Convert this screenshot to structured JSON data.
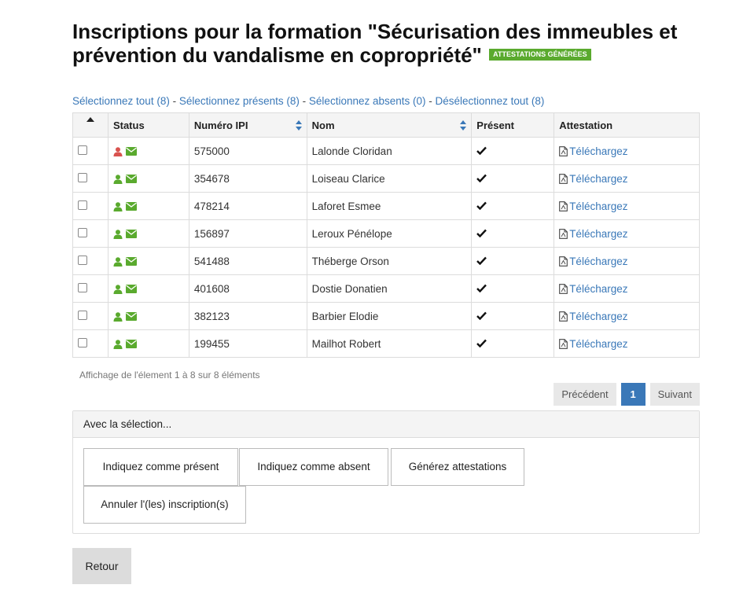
{
  "page": {
    "title": "Inscriptions pour la formation \"Sécurisation des immeubles et prévention du vandalisme en copropriété\"",
    "badge": "ATTESTATIONS GÉNÉRÉES"
  },
  "selection_links": {
    "all": "Sélectionnez tout (8)",
    "sep1": " - ",
    "present": "Sélectionnez présents (8)",
    "sep2": " - ",
    "absent": "Sélectionnez absents (0)",
    "sep3": " - ",
    "none": "Désélectionnez tout (8)"
  },
  "table": {
    "headers": {
      "status": "Status",
      "ipi": "Numéro IPI",
      "name": "Nom",
      "present": "Présent",
      "attestation": "Attestation"
    },
    "download_label": "Téléchargez",
    "rows": [
      {
        "ipi": "575000",
        "name": "Lalonde Cloridan",
        "user_color": "#d9534f"
      },
      {
        "ipi": "354678",
        "name": "Loiseau Clarice",
        "user_color": "#5aaa2e"
      },
      {
        "ipi": "478214",
        "name": "Laforet Esmee",
        "user_color": "#5aaa2e"
      },
      {
        "ipi": "156897",
        "name": "Leroux Pénélope",
        "user_color": "#5aaa2e"
      },
      {
        "ipi": "541488",
        "name": "Théberge Orson",
        "user_color": "#5aaa2e"
      },
      {
        "ipi": "401608",
        "name": "Dostie Donatien",
        "user_color": "#5aaa2e"
      },
      {
        "ipi": "382123",
        "name": "Barbier Elodie",
        "user_color": "#5aaa2e"
      },
      {
        "ipi": "199455",
        "name": "Mailhot Robert",
        "user_color": "#5aaa2e"
      }
    ]
  },
  "info": "Affichage de l'élement 1 à 8 sur 8 éléments",
  "pagination": {
    "prev": "Précédent",
    "current": "1",
    "next": "Suivant"
  },
  "bulk": {
    "heading": "Avec la sélection...",
    "mark_present": "Indiquez comme présent",
    "mark_absent": "Indiquez comme absent",
    "generate": "Générez attestations",
    "cancel": "Annuler l'(les) inscription(s)"
  },
  "back": "Retour",
  "colors": {
    "accent": "#3a78b8",
    "success": "#5aaa2e",
    "danger": "#d9534f"
  },
  "icons": [
    "user-icon",
    "envelope-icon",
    "check-icon",
    "pdf-icon",
    "sort-icon"
  ]
}
